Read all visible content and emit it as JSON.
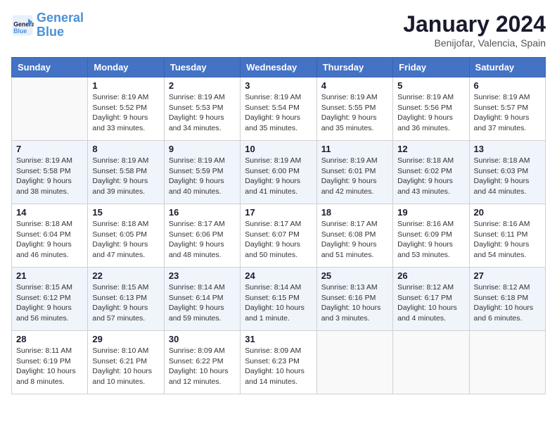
{
  "logo": {
    "line1": "General",
    "line2": "Blue"
  },
  "title": "January 2024",
  "location": "Benijofar, Valencia, Spain",
  "days_header": [
    "Sunday",
    "Monday",
    "Tuesday",
    "Wednesday",
    "Thursday",
    "Friday",
    "Saturday"
  ],
  "weeks": [
    [
      {
        "day": "",
        "sunrise": "",
        "sunset": "",
        "daylight": ""
      },
      {
        "day": "1",
        "sunrise": "Sunrise: 8:19 AM",
        "sunset": "Sunset: 5:52 PM",
        "daylight": "Daylight: 9 hours and 33 minutes."
      },
      {
        "day": "2",
        "sunrise": "Sunrise: 8:19 AM",
        "sunset": "Sunset: 5:53 PM",
        "daylight": "Daylight: 9 hours and 34 minutes."
      },
      {
        "day": "3",
        "sunrise": "Sunrise: 8:19 AM",
        "sunset": "Sunset: 5:54 PM",
        "daylight": "Daylight: 9 hours and 35 minutes."
      },
      {
        "day": "4",
        "sunrise": "Sunrise: 8:19 AM",
        "sunset": "Sunset: 5:55 PM",
        "daylight": "Daylight: 9 hours and 35 minutes."
      },
      {
        "day": "5",
        "sunrise": "Sunrise: 8:19 AM",
        "sunset": "Sunset: 5:56 PM",
        "daylight": "Daylight: 9 hours and 36 minutes."
      },
      {
        "day": "6",
        "sunrise": "Sunrise: 8:19 AM",
        "sunset": "Sunset: 5:57 PM",
        "daylight": "Daylight: 9 hours and 37 minutes."
      }
    ],
    [
      {
        "day": "7",
        "sunrise": "Sunrise: 8:19 AM",
        "sunset": "Sunset: 5:58 PM",
        "daylight": "Daylight: 9 hours and 38 minutes."
      },
      {
        "day": "8",
        "sunrise": "Sunrise: 8:19 AM",
        "sunset": "Sunset: 5:58 PM",
        "daylight": "Daylight: 9 hours and 39 minutes."
      },
      {
        "day": "9",
        "sunrise": "Sunrise: 8:19 AM",
        "sunset": "Sunset: 5:59 PM",
        "daylight": "Daylight: 9 hours and 40 minutes."
      },
      {
        "day": "10",
        "sunrise": "Sunrise: 8:19 AM",
        "sunset": "Sunset: 6:00 PM",
        "daylight": "Daylight: 9 hours and 41 minutes."
      },
      {
        "day": "11",
        "sunrise": "Sunrise: 8:19 AM",
        "sunset": "Sunset: 6:01 PM",
        "daylight": "Daylight: 9 hours and 42 minutes."
      },
      {
        "day": "12",
        "sunrise": "Sunrise: 8:18 AM",
        "sunset": "Sunset: 6:02 PM",
        "daylight": "Daylight: 9 hours and 43 minutes."
      },
      {
        "day": "13",
        "sunrise": "Sunrise: 8:18 AM",
        "sunset": "Sunset: 6:03 PM",
        "daylight": "Daylight: 9 hours and 44 minutes."
      }
    ],
    [
      {
        "day": "14",
        "sunrise": "Sunrise: 8:18 AM",
        "sunset": "Sunset: 6:04 PM",
        "daylight": "Daylight: 9 hours and 46 minutes."
      },
      {
        "day": "15",
        "sunrise": "Sunrise: 8:18 AM",
        "sunset": "Sunset: 6:05 PM",
        "daylight": "Daylight: 9 hours and 47 minutes."
      },
      {
        "day": "16",
        "sunrise": "Sunrise: 8:17 AM",
        "sunset": "Sunset: 6:06 PM",
        "daylight": "Daylight: 9 hours and 48 minutes."
      },
      {
        "day": "17",
        "sunrise": "Sunrise: 8:17 AM",
        "sunset": "Sunset: 6:07 PM",
        "daylight": "Daylight: 9 hours and 50 minutes."
      },
      {
        "day": "18",
        "sunrise": "Sunrise: 8:17 AM",
        "sunset": "Sunset: 6:08 PM",
        "daylight": "Daylight: 9 hours and 51 minutes."
      },
      {
        "day": "19",
        "sunrise": "Sunrise: 8:16 AM",
        "sunset": "Sunset: 6:09 PM",
        "daylight": "Daylight: 9 hours and 53 minutes."
      },
      {
        "day": "20",
        "sunrise": "Sunrise: 8:16 AM",
        "sunset": "Sunset: 6:11 PM",
        "daylight": "Daylight: 9 hours and 54 minutes."
      }
    ],
    [
      {
        "day": "21",
        "sunrise": "Sunrise: 8:15 AM",
        "sunset": "Sunset: 6:12 PM",
        "daylight": "Daylight: 9 hours and 56 minutes."
      },
      {
        "day": "22",
        "sunrise": "Sunrise: 8:15 AM",
        "sunset": "Sunset: 6:13 PM",
        "daylight": "Daylight: 9 hours and 57 minutes."
      },
      {
        "day": "23",
        "sunrise": "Sunrise: 8:14 AM",
        "sunset": "Sunset: 6:14 PM",
        "daylight": "Daylight: 9 hours and 59 minutes."
      },
      {
        "day": "24",
        "sunrise": "Sunrise: 8:14 AM",
        "sunset": "Sunset: 6:15 PM",
        "daylight": "Daylight: 10 hours and 1 minute."
      },
      {
        "day": "25",
        "sunrise": "Sunrise: 8:13 AM",
        "sunset": "Sunset: 6:16 PM",
        "daylight": "Daylight: 10 hours and 3 minutes."
      },
      {
        "day": "26",
        "sunrise": "Sunrise: 8:12 AM",
        "sunset": "Sunset: 6:17 PM",
        "daylight": "Daylight: 10 hours and 4 minutes."
      },
      {
        "day": "27",
        "sunrise": "Sunrise: 8:12 AM",
        "sunset": "Sunset: 6:18 PM",
        "daylight": "Daylight: 10 hours and 6 minutes."
      }
    ],
    [
      {
        "day": "28",
        "sunrise": "Sunrise: 8:11 AM",
        "sunset": "Sunset: 6:19 PM",
        "daylight": "Daylight: 10 hours and 8 minutes."
      },
      {
        "day": "29",
        "sunrise": "Sunrise: 8:10 AM",
        "sunset": "Sunset: 6:21 PM",
        "daylight": "Daylight: 10 hours and 10 minutes."
      },
      {
        "day": "30",
        "sunrise": "Sunrise: 8:09 AM",
        "sunset": "Sunset: 6:22 PM",
        "daylight": "Daylight: 10 hours and 12 minutes."
      },
      {
        "day": "31",
        "sunrise": "Sunrise: 8:09 AM",
        "sunset": "Sunset: 6:23 PM",
        "daylight": "Daylight: 10 hours and 14 minutes."
      },
      {
        "day": "",
        "sunrise": "",
        "sunset": "",
        "daylight": ""
      },
      {
        "day": "",
        "sunrise": "",
        "sunset": "",
        "daylight": ""
      },
      {
        "day": "",
        "sunrise": "",
        "sunset": "",
        "daylight": ""
      }
    ]
  ]
}
